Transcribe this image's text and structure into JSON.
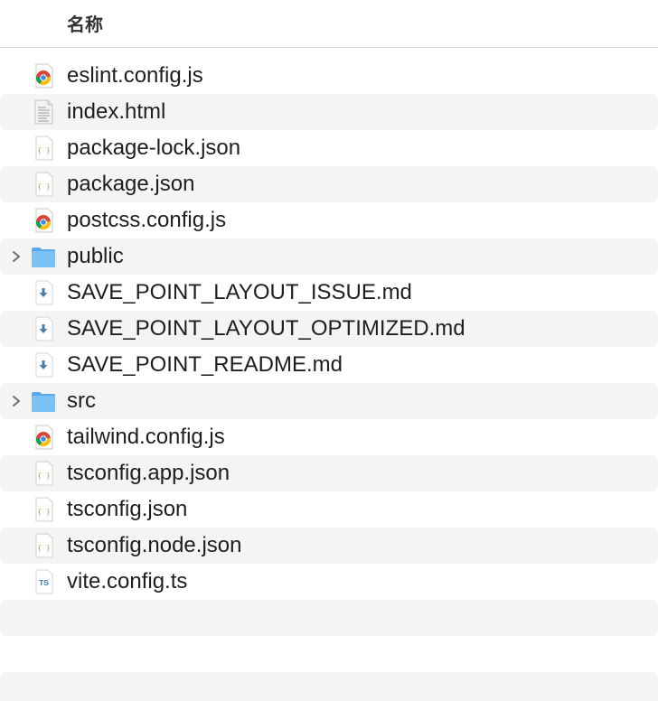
{
  "header": {
    "name_label": "名称"
  },
  "files": [
    {
      "name": "eslint.config.js",
      "icon": "chrome-icon",
      "folder": false
    },
    {
      "name": "index.html",
      "icon": "html-document-icon",
      "folder": false
    },
    {
      "name": "package-lock.json",
      "icon": "json-file-icon",
      "folder": false
    },
    {
      "name": "package.json",
      "icon": "json-file-icon",
      "folder": false
    },
    {
      "name": "postcss.config.js",
      "icon": "chrome-icon",
      "folder": false
    },
    {
      "name": "public",
      "icon": "folder-icon",
      "folder": true
    },
    {
      "name": "SAVE_POINT_LAYOUT_ISSUE.md",
      "icon": "markdown-file-icon",
      "folder": false
    },
    {
      "name": "SAVE_POINT_LAYOUT_OPTIMIZED.md",
      "icon": "markdown-file-icon",
      "folder": false
    },
    {
      "name": "SAVE_POINT_README.md",
      "icon": "markdown-file-icon",
      "folder": false
    },
    {
      "name": "src",
      "icon": "folder-icon",
      "folder": true
    },
    {
      "name": "tailwind.config.js",
      "icon": "chrome-icon",
      "folder": false
    },
    {
      "name": "tsconfig.app.json",
      "icon": "json-file-icon",
      "folder": false
    },
    {
      "name": "tsconfig.json",
      "icon": "json-file-icon",
      "folder": false
    },
    {
      "name": "tsconfig.node.json",
      "icon": "json-file-icon",
      "folder": false
    },
    {
      "name": "vite.config.ts",
      "icon": "typescript-file-icon",
      "folder": false
    }
  ],
  "colors": {
    "stripe": "#f4f4f5",
    "folder": "#6cb4ee",
    "divider": "#d8d8d8"
  }
}
